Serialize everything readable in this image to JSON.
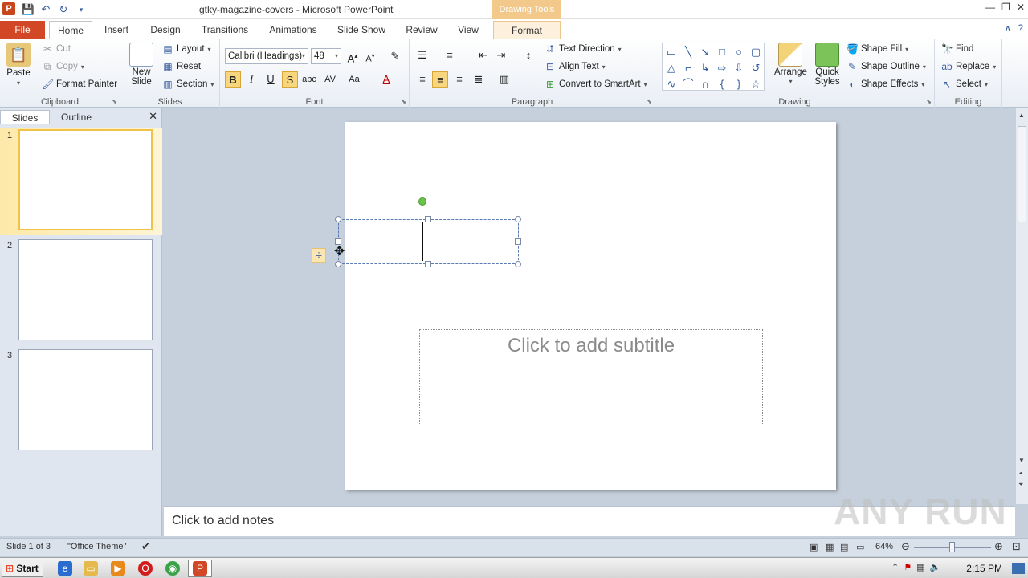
{
  "window": {
    "title": "gtky-magazine-covers - Microsoft PowerPoint",
    "context_tab_group": "Drawing Tools"
  },
  "tabs": [
    "File",
    "Home",
    "Insert",
    "Design",
    "Transitions",
    "Animations",
    "Slide Show",
    "Review",
    "View",
    "Format"
  ],
  "ribbon": {
    "clipboard": {
      "label": "Clipboard",
      "paste": "Paste",
      "cut": "Cut",
      "copy": "Copy",
      "format_painter": "Format Painter"
    },
    "slides": {
      "label": "Slides",
      "new_slide": "New Slide",
      "layout": "Layout",
      "reset": "Reset",
      "section": "Section"
    },
    "font": {
      "label": "Font",
      "font_name": "Calibri (Headings)",
      "font_size": "48"
    },
    "paragraph": {
      "label": "Paragraph",
      "text_direction": "Text Direction",
      "align_text": "Align Text",
      "convert_smartart": "Convert to SmartArt"
    },
    "drawing": {
      "label": "Drawing",
      "arrange": "Arrange",
      "quick_styles": "Quick Styles",
      "shape_fill": "Shape Fill",
      "shape_outline": "Shape Outline",
      "shape_effects": "Shape Effects"
    },
    "editing": {
      "label": "Editing",
      "find": "Find",
      "replace": "Replace",
      "select": "Select"
    }
  },
  "pane": {
    "tab_slides": "Slides",
    "tab_outline": "Outline",
    "slide_numbers": [
      "1",
      "2",
      "3"
    ]
  },
  "slide": {
    "subtitle_placeholder": "Click to add subtitle"
  },
  "notes": {
    "placeholder": "Click to add notes"
  },
  "status": {
    "slide_info": "Slide 1 of 3",
    "theme": "\"Office Theme\"",
    "zoom": "64%",
    "zoom_level": 0.5
  },
  "taskbar": {
    "start": "Start",
    "clock": "2:15 PM"
  },
  "watermark": "ANY RUN"
}
